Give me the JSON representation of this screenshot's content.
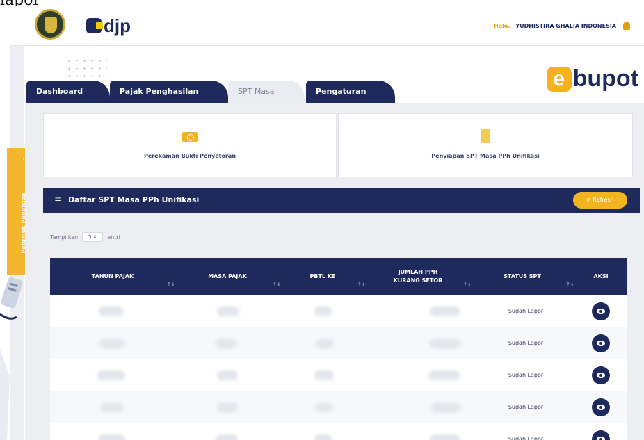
{
  "caption": "lapor",
  "header": {
    "brand": "djp",
    "greeting": "Halo,",
    "user_name": "YUDHISTIRA GHALIA INDONESIA"
  },
  "side_tab": {
    "label": "Petunjuk Pengisian"
  },
  "logo": {
    "text": "bupot",
    "letter": "e"
  },
  "tabs": [
    {
      "label": "Dashboard",
      "active": false
    },
    {
      "label": "Pajak Penghasilan",
      "active": false
    },
    {
      "label": "SPT Masa",
      "active": true
    },
    {
      "label": "Pengaturan",
      "active": false
    }
  ],
  "cards": [
    {
      "label": "Perekaman Bukti Penyetoran",
      "icon": "money-icon"
    },
    {
      "label": "Penyiapan SPT Masa PPh Unifikasi",
      "icon": "clipboard-icon"
    }
  ],
  "list": {
    "title": "Daftar SPT Masa PPh Unifikasi",
    "refresh_label": "Refresh"
  },
  "entries": {
    "prefix": "Tampilkan",
    "value": "5",
    "suffix": "entri"
  },
  "table": {
    "columns": [
      "TAHUN PAJAK",
      "MASA PAJAK",
      "PBTL KE",
      "JUMLAH PPH KURANG SETOR",
      "STATUS SPT",
      "AKSI"
    ],
    "rows": [
      {
        "status": "Sudah Lapor"
      },
      {
        "status": "Sudah Lapor"
      },
      {
        "status": "Sudah Lapor"
      },
      {
        "status": "Sudah Lapor"
      },
      {
        "status": "Sudah Lapor"
      }
    ]
  },
  "colors": {
    "navy": "#1f2a5c",
    "accent": "#f4b62e"
  }
}
